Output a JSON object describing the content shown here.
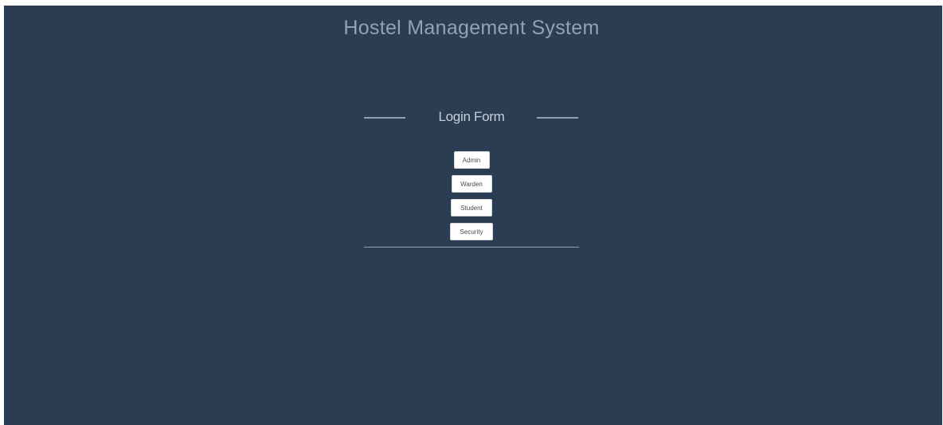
{
  "header": {
    "title": "Hostel Management System"
  },
  "login_form": {
    "title": "Login Form",
    "buttons": [
      {
        "label": "Admin"
      },
      {
        "label": "Warden"
      },
      {
        "label": "Student"
      },
      {
        "label": "Security"
      }
    ]
  },
  "colors": {
    "background": "#2b3d53",
    "title_text": "#8ea3b8",
    "form_title_text": "#c6d0da",
    "button_bg": "#ffffff"
  }
}
